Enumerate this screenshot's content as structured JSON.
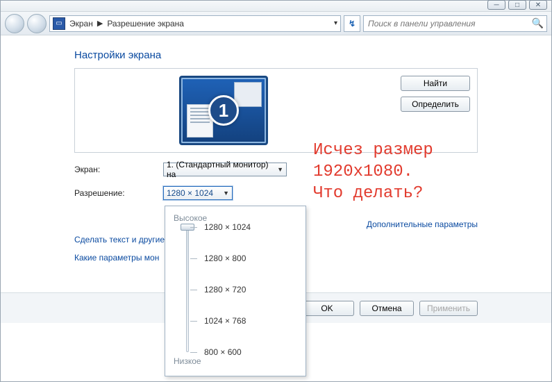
{
  "window": {
    "min_glyph": "─",
    "max_glyph": "□",
    "close_glyph": "✕"
  },
  "toolbar": {
    "crumb1": "Экран",
    "crumb2": "Разрешение экрана",
    "refresh_glyph": "↯",
    "search_placeholder": "Поиск в панели управления"
  },
  "page": {
    "title": "Настройки экрана",
    "monitor_badge": "1",
    "btn_find": "Найти",
    "btn_identify": "Определить",
    "label_display": "Экран:",
    "value_display": "1. (Стандартный монитор) на",
    "label_resolution": "Разрешение:",
    "value_resolution": "1280 × 1024",
    "link_text_size": "Сделать текст и другие",
    "link_which_params": "Какие параметры мон",
    "link_advanced": "Дополнительные параметры",
    "btn_ok": "OK",
    "btn_cancel": "Отмена",
    "btn_apply": "Применить"
  },
  "resolution_popup": {
    "label_high": "Высокое",
    "label_low": "Низкое",
    "options": [
      "1280 × 1024",
      "1280 × 800",
      "1280 × 720",
      "1024 × 768",
      "800 × 600"
    ],
    "selected_index": 0
  },
  "annotation": {
    "text": "Исчез размер\n1920х1080.\nЧто делать?"
  }
}
